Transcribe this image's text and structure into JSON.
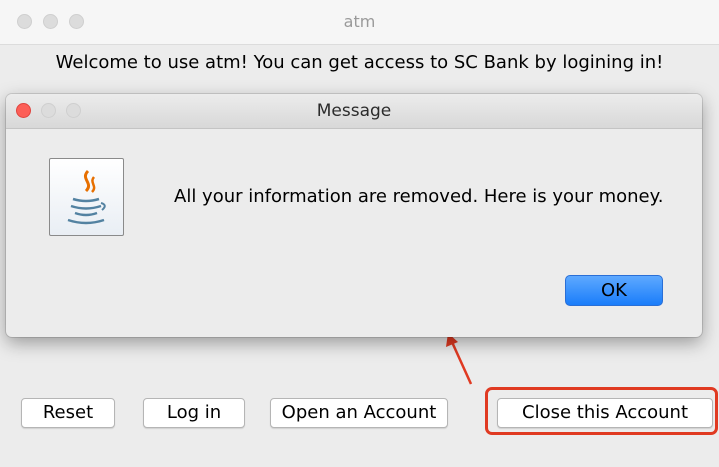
{
  "window": {
    "title": "atm"
  },
  "welcome_text": "Welcome to use atm! You can get access to SC Bank by logining in!",
  "dialog": {
    "title": "Message",
    "icon": "java-icon",
    "message": "All your information are removed. Here is your money.",
    "ok_label": "OK"
  },
  "buttons": {
    "reset": "Reset",
    "login": "Log in",
    "open_account": "Open an Account",
    "close_account": "Close this Account"
  },
  "annotation": {
    "highlight_color": "#e03a22"
  },
  "colors": {
    "close_traffic": "#fc5f57",
    "ok_accent": "#1a7dfa"
  }
}
